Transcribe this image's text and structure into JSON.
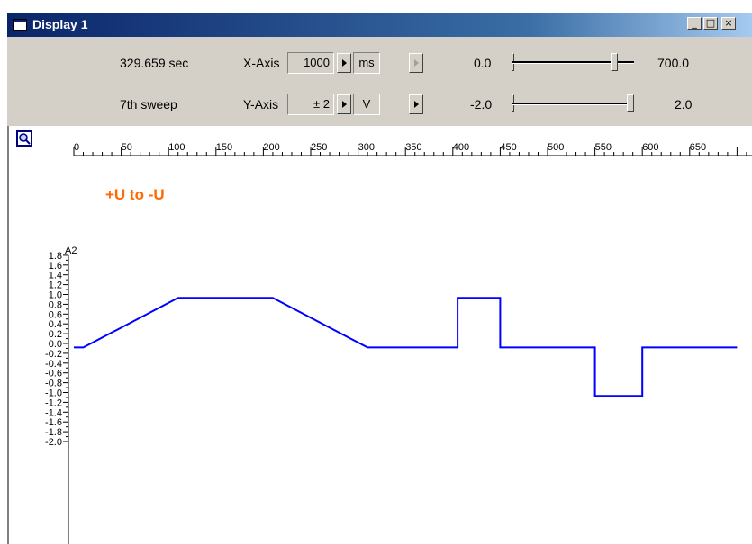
{
  "window": {
    "title": "Display 1"
  },
  "title_buttons": [
    "_",
    "□",
    "×"
  ],
  "toolbar": {
    "time": "329.659 sec",
    "sweep": "7th sweep",
    "x_axis": {
      "label": "X-Axis",
      "value": "1000",
      "unit": "ms"
    },
    "y_axis": {
      "label": "Y-Axis",
      "value": "± 2",
      "unit": "V"
    },
    "x_range": {
      "min": "0.0",
      "max": "700.0",
      "position": 0.86
    },
    "y_range": {
      "min": "-2.0",
      "max": "2.0",
      "position": 1.0
    }
  },
  "chart_data": {
    "type": "line",
    "channel_label": "A2",
    "annotation": "+U to -U",
    "xlim": [
      0,
      700
    ],
    "ylim": [
      -2.0,
      1.8
    ],
    "x_ticks": [
      "0",
      "50",
      "100",
      "150",
      "200",
      "250",
      "300",
      "350",
      "400",
      "450",
      "500",
      "550",
      "600",
      "650"
    ],
    "y_ticks": [
      "1.8",
      "1.6",
      "1.4",
      "1.2",
      "1.0",
      "0.8",
      "0.6",
      "0.4",
      "0.2",
      "0.0",
      "-0.2",
      "-0.4",
      "-0.6",
      "-0.8",
      "-1.0",
      "-1.2",
      "-1.4",
      "-1.6",
      "-1.8",
      "-2.0"
    ],
    "series": [
      {
        "color": "#0000ff",
        "x": [
          0,
          10,
          110,
          210,
          310,
          405,
          405,
          450,
          450,
          550,
          550,
          600,
          600,
          700
        ],
        "y": [
          -0.08,
          -0.08,
          0.93,
          0.93,
          -0.08,
          -0.08,
          0.93,
          0.93,
          -0.08,
          -0.08,
          -1.07,
          -1.07,
          -0.08,
          -0.08
        ]
      }
    ],
    "colors": {
      "annotation": "#ff6a00",
      "trace": "#0000ff"
    }
  }
}
